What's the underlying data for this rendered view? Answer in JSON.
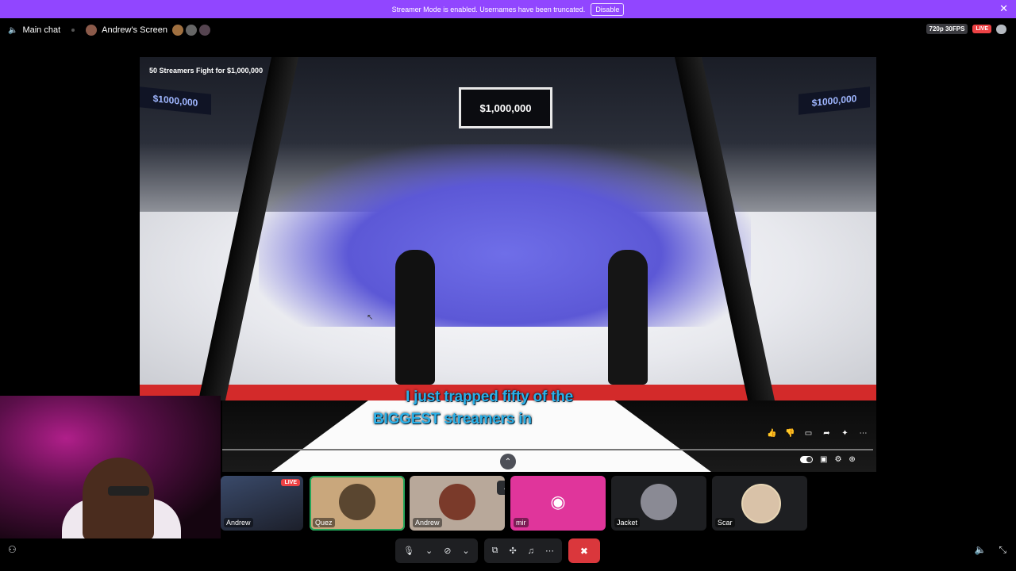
{
  "banner": {
    "text": "Streamer Mode is enabled. Usernames have been truncated.",
    "disable_label": "Disable",
    "close_icon": "close-icon",
    "color": "#9146ff"
  },
  "topbar": {
    "channel": "Main chat",
    "screen_label": "Andrew's Screen",
    "quality": "720p 30FPS",
    "live": "LIVE"
  },
  "video": {
    "title": "50 Streamers Fight for $1,000,000",
    "prize_sign": "$1,000,000",
    "left_sign": "$1000,000",
    "right_sign": "$1000,000",
    "caption_line1": "I just trapped fifty of the",
    "caption_line2": "BIGGEST streamers in",
    "caption_color": "#2ab0e8"
  },
  "tiles": [
    {
      "name": "Andrew",
      "badge": "LIVE"
    },
    {
      "name": "Quez"
    },
    {
      "name": "Andrew"
    },
    {
      "name": "mir"
    },
    {
      "name": "Jacket"
    },
    {
      "name": "Scar"
    }
  ],
  "colors": {
    "live_red": "#ed4245",
    "speaking_green": "#23a559",
    "end_call": "#da373c",
    "discord_pink": "#e0359b"
  }
}
